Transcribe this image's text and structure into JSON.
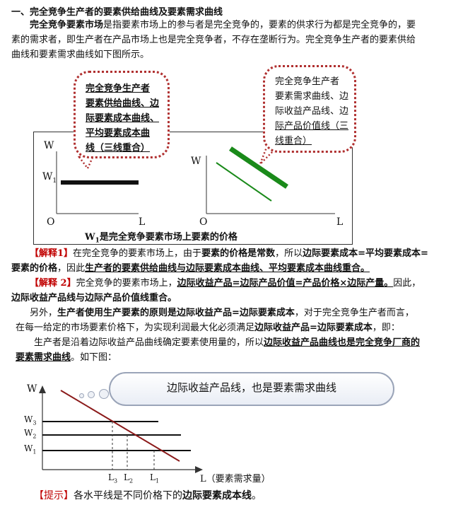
{
  "heading": "一、完全竞争生产者的要素供给曲线及要素需求曲线",
  "intro": {
    "term": "完全竞争要素市场",
    "l1_rest": "是指要素市场上的参与者是完全竞争的，要素的供求行为都是完全竞争的，要",
    "l2": "素的需求者，即生产者在产品市场上也是完全竞争者，不存在垄断行为。完全竞争生产者的要素供给",
    "l3": "曲线和要素需求曲线如下图所示。"
  },
  "figure1": {
    "callout_left": [
      "完全竞争生产者",
      "要素供给曲线、边",
      "际要素成本曲线、",
      "平均要素成本曲",
      "线（三线重合）"
    ],
    "callout_right": [
      "完全竞争生产者",
      "要素需求曲线、边",
      "际收益产品线、边",
      "际产品价值线（三",
      "线重合）"
    ],
    "left_axes": {
      "y": "W",
      "y_tick": "W",
      "y_tick_sub": "1",
      "origin": "O",
      "x": "L"
    },
    "right_axes": {
      "y": "W",
      "origin": "O",
      "x": "L"
    },
    "caption_w": "W",
    "caption_sub": "1",
    "caption_rest": "是完全竞争要素市场上要素的价格"
  },
  "note1": {
    "tag": "【解释1】",
    "p1": "在完全竞争的要素市场上，由于",
    "p2": "要素的价格是常数",
    "p3": "，所以",
    "p4": "边际要素成本=平均要素成本=",
    "p5": "要素的价格",
    "p6": "，因此",
    "p7": "生产者的要素供给曲线与边际要素成本曲线、平均要素成本曲线重合。"
  },
  "note2": {
    "tag": "【解释 2】",
    "p1": "完全竞争的要素市场上，",
    "p2": "边际收益产品=边际产品价值=产品价格×边际产量。",
    "p3": "因此，",
    "p4": "边际收益产品线与边际产品价值线重合。"
  },
  "para3": {
    "p1": "另外，",
    "p2": "生产者使用生产要素的原则是边际收益产品=边际要素成本",
    "p3": "，对于完全竞争生产者而言，",
    "p4": "在每一给定的市场要素价格下，为实现利润最大化必须满足",
    "p5": "边际收益产品=边际要素成本",
    "p6": "，即："
  },
  "para4": {
    "p1": "生产者是沿着边际收益产品曲线确定要素使用量的，所以",
    "p2": "边际收益产品曲线也是完全竞争厂商的",
    "p3": "要素需求曲线",
    "p4": "。如下图："
  },
  "figure2": {
    "cloud_text": "边际收益产品线，也是要素需求曲线",
    "y_label": "W",
    "w_levels": [
      {
        "label": "W",
        "sub": "3"
      },
      {
        "label": "W",
        "sub": "2"
      },
      {
        "label": "W",
        "sub": "1"
      }
    ],
    "l_points": [
      {
        "label": "L",
        "sub": "3"
      },
      {
        "label": "L",
        "sub": "2"
      },
      {
        "label": "L",
        "sub": "1"
      }
    ],
    "x_label": "L（要素需求量）",
    "line_color": "#8b1a1a"
  },
  "hint": {
    "tag": "【提示】",
    "p1": "各水平线是不同价格下的",
    "p2": "边际要素成本线",
    "p3": "。"
  }
}
